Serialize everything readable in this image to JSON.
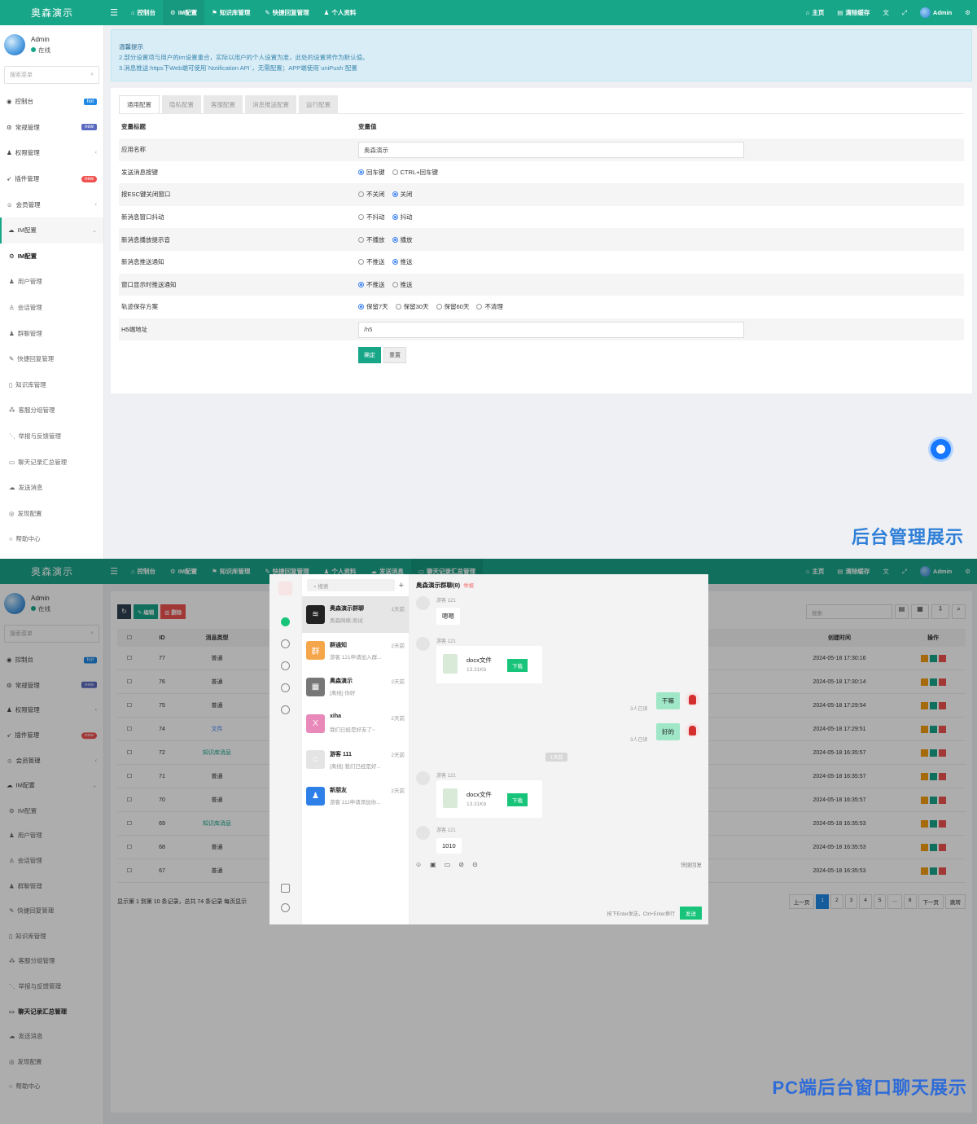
{
  "top": {
    "brand": "奥森演示",
    "nav": [
      "控制台",
      "IM配置",
      "知识库管理",
      "快捷回复管理",
      "个人资料"
    ],
    "nav2": [
      "控制台",
      "IM配置",
      "知识库管理",
      "快捷回复管理",
      "个人资料",
      "发送消息",
      "聊天记录汇总管理"
    ],
    "right": {
      "home": "主页",
      "clear": "清除缓存",
      "user": "Admin"
    }
  },
  "user": {
    "name": "Admin",
    "status": "在线",
    "search_placeholder": "搜索菜单"
  },
  "sidebar": [
    {
      "label": "控制台",
      "badge": "hot"
    },
    {
      "label": "常规管理",
      "badge": "new"
    },
    {
      "label": "权限管理",
      "chevron": "‹"
    },
    {
      "label": "插件管理",
      "badge": "new"
    },
    {
      "label": "会员管理",
      "chevron": "‹"
    },
    {
      "label": "IM配置",
      "chevron": "⌄"
    },
    {
      "label": "IM配置"
    },
    {
      "label": "用户管理"
    },
    {
      "label": "会话管理"
    },
    {
      "label": "群聊管理"
    },
    {
      "label": "快捷回复管理"
    },
    {
      "label": "知识库管理"
    },
    {
      "label": "客服分组管理"
    },
    {
      "label": "举报与反馈管理"
    },
    {
      "label": "聊天记录汇总管理"
    },
    {
      "label": "发送消息"
    },
    {
      "label": "发现配置"
    },
    {
      "label": "帮助中心"
    }
  ],
  "tips": {
    "title": "温馨提示",
    "line1": "2.部分设置项与用户的im设置重合，实际以用户的个人设置为准，此处的设置将作为默认值。",
    "line2": "3.消息推送:https下Web端可使用`Notification API`，无需配置；APP端使用`uniPush`配置"
  },
  "tabs": [
    "通用配置",
    "隐私配置",
    "客服配置",
    "消息推送配置",
    "运行配置"
  ],
  "config": {
    "head_key": "变量标题",
    "head_val": "变量值",
    "rows": [
      {
        "key": "应用名称",
        "input": "奥森演示"
      },
      {
        "key": "发送消息按键",
        "options": [
          "回车键",
          "CTRL+回车键"
        ],
        "selected": 0
      },
      {
        "key": "按ESC键关闭窗口",
        "options": [
          "不关闭",
          "关闭"
        ],
        "selected": 1
      },
      {
        "key": "新消息窗口抖动",
        "options": [
          "不抖动",
          "抖动"
        ],
        "selected": 1
      },
      {
        "key": "新消息播放提示音",
        "options": [
          "不播放",
          "播放"
        ],
        "selected": 1
      },
      {
        "key": "新消息推送通知",
        "options": [
          "不推送",
          "推送"
        ],
        "selected": 1
      },
      {
        "key": "窗口显示时推送通知",
        "options": [
          "不推送",
          "推送"
        ],
        "selected": 0
      },
      {
        "key": "轨迹保存方案",
        "options": [
          "保留7天",
          "保留30天",
          "保留60天",
          "不清理"
        ],
        "selected": 0
      },
      {
        "key": "H5端地址",
        "input": "/h5"
      }
    ],
    "ok": "确定",
    "reset": "重置"
  },
  "caption1": "后台管理展示",
  "caption2": "PC端后台窗口聊天展示",
  "table": {
    "edit": "编辑",
    "del": "删除",
    "search_placeholder": "搜索",
    "headers": [
      "ID",
      "消息类型",
      "创建时间",
      "操作"
    ],
    "rows": [
      {
        "id": "77",
        "type": "普通",
        "time": "2024-05-18 17:30:16"
      },
      {
        "id": "76",
        "type": "普通",
        "time": "2024-05-18 17:30:14"
      },
      {
        "id": "75",
        "type": "普通",
        "time": "2024-05-18 17:29:54"
      },
      {
        "id": "74",
        "type": "文件",
        "time": "2024-05-18 17:29:51"
      },
      {
        "id": "72",
        "type": "知识库消息",
        "time": "2024-05-18 16:35:57"
      },
      {
        "id": "71",
        "type": "普通",
        "time": "2024-05-18 16:35:57"
      },
      {
        "id": "70",
        "type": "普通",
        "time": "2024-05-18 16:35:57"
      },
      {
        "id": "69",
        "type": "知识库消息",
        "time": "2024-05-18 16:35:53"
      },
      {
        "id": "68",
        "type": "普通",
        "time": "2024-05-18 16:35:53"
      },
      {
        "id": "67",
        "type": "普通",
        "time": "2024-05-18 16:35:53"
      }
    ],
    "footer": "显示第 1 到第 10 条记录，总共 74 条记录 每页显示",
    "pager": [
      "上一页",
      "1",
      "2",
      "3",
      "4",
      "5",
      "...",
      "8",
      "下一页",
      "跳转"
    ]
  },
  "chat": {
    "search": "搜索",
    "title": "奥森演示群聊(8)",
    "report": "举报",
    "list": [
      {
        "name": "奥森演示群聊",
        "time": "1天前",
        "preview": "奥森网络:测试",
        "color": "#222222",
        "glyph": "≋"
      },
      {
        "name": "群通知",
        "time": "2天前",
        "preview": "游客 121申请加入群...",
        "color": "#f5a54a",
        "glyph": "群"
      },
      {
        "name": "奥森演示",
        "time": "2天前",
        "preview": "[离线] 你好",
        "color": "#777777",
        "glyph": "▦"
      },
      {
        "name": "xiha",
        "time": "2天前",
        "preview": "我们已经是好友了~",
        "color": "#e889b9",
        "glyph": "X"
      },
      {
        "name": "游客 111",
        "time": "2天前",
        "preview": "[离线] 我们已经是好...",
        "color": "#e4e4e4",
        "glyph": "☺"
      },
      {
        "name": "新朋友",
        "time": "2天前",
        "preview": "游客 111申请添加你...",
        "color": "#2f7fe8",
        "glyph": "♟"
      }
    ],
    "sender": "游客 121",
    "msg1": "嗯嗯",
    "file_name": "docx文件",
    "file_size": "13.31Kb",
    "download": "下载",
    "me1": "干嘛",
    "me2": "好的",
    "read": "3人已读",
    "day_tag": "1天前",
    "msg_last": "1010",
    "quick": "快捷回复",
    "hint": "按下Enter发送，Ctrl+Enter换行",
    "send": "发送"
  }
}
